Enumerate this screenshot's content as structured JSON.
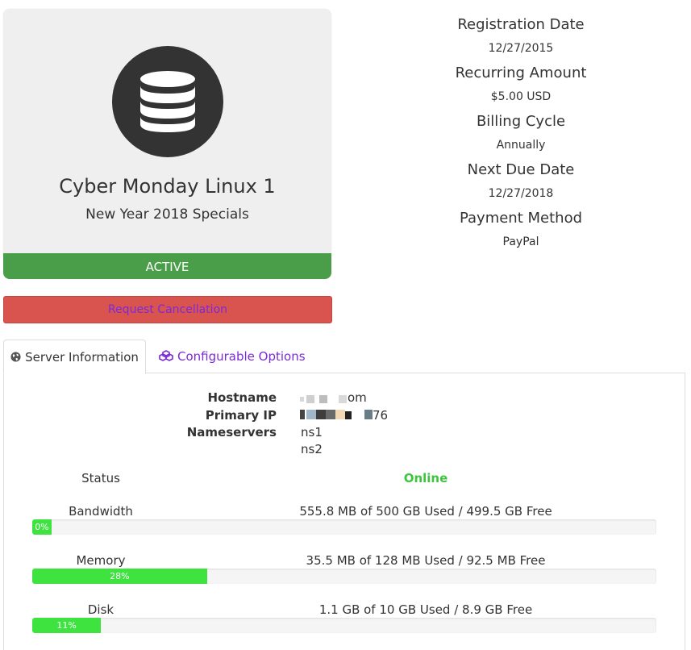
{
  "product": {
    "name": "Cyber Monday Linux 1",
    "group": "New Year 2018 Specials",
    "status": "ACTIVE",
    "status_color": "#4a9e4a",
    "icon": "database-icon"
  },
  "actions": {
    "cancel_label": "Request Cancellation",
    "cancel_color": "#d9534f"
  },
  "details": [
    {
      "label": "Registration Date",
      "value": "12/27/2015"
    },
    {
      "label": "Recurring Amount",
      "value": "$5.00 USD"
    },
    {
      "label": "Billing Cycle",
      "value": "Annually"
    },
    {
      "label": "Next Due Date",
      "value": "12/27/2018"
    },
    {
      "label": "Payment Method",
      "value": "PayPal"
    }
  ],
  "tabs": [
    {
      "label": "Server Information",
      "icon": "globe-icon",
      "active": true
    },
    {
      "label": "Configurable Options",
      "icon": "cubes-icon",
      "active": false
    }
  ],
  "server": {
    "hostname_label": "Hostname",
    "hostname_value": "om",
    "ip_label": "Primary IP",
    "ip_value": "76",
    "nameservers_label": "Nameservers",
    "ns1": "ns1",
    "ns2": "ns2",
    "status_label": "Status",
    "status_value": "Online",
    "status_color": "#3ec43e"
  },
  "usage": [
    {
      "label": "Bandwidth",
      "text": "555.8 MB of 500 GB Used / 499.5 GB Free",
      "percent_label": "0%",
      "fraction": 0.0
    },
    {
      "label": "Memory",
      "text": "35.5 MB of 128 MB Used / 92.5 MB Free",
      "percent_label": "28%",
      "fraction": 0.28
    },
    {
      "label": "Disk",
      "text": "1.1 GB of 10 GB Used / 8.9 GB Free",
      "percent_label": "11%",
      "fraction": 0.11
    }
  ]
}
